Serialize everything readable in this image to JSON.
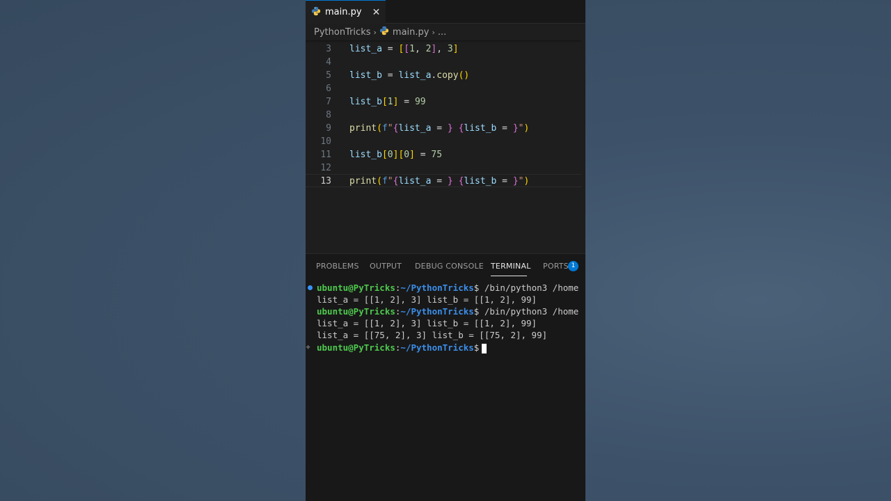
{
  "tab": {
    "label": "main.py",
    "close": "✕",
    "icon": "python-icon"
  },
  "breadcrumb": {
    "folder": "PythonTricks",
    "file": "main.py",
    "more": "...",
    "sep": "›"
  },
  "editor": {
    "current_line": 13,
    "lines": [
      {
        "num": "3"
      },
      {
        "num": "4"
      },
      {
        "num": "5"
      },
      {
        "num": "6"
      },
      {
        "num": "7"
      },
      {
        "num": "8"
      },
      {
        "num": "9"
      },
      {
        "num": "10"
      },
      {
        "num": "11"
      },
      {
        "num": "12"
      },
      {
        "num": "13"
      }
    ],
    "tokens": {
      "l3": [
        "list_a",
        " = ",
        "[",
        "[",
        "1",
        ", ",
        "2",
        "]",
        ", ",
        "3",
        "]"
      ],
      "l5": [
        "list_b",
        " = ",
        "list_a",
        ".",
        "copy",
        "(",
        ")"
      ],
      "l7": [
        "list_b",
        "[",
        "1",
        "]",
        " = ",
        "99"
      ],
      "l9": [
        "print",
        "(",
        "f",
        "\"",
        "{",
        "list_a",
        " = ",
        "}",
        " ",
        "{",
        "list_b",
        " = ",
        "}",
        "\"",
        ")"
      ],
      "l11": [
        "list_b",
        "[",
        "0",
        "]",
        "[",
        "0",
        "]",
        " = ",
        "75"
      ],
      "l13": [
        "print",
        "(",
        "f",
        "\"",
        "{",
        "list_a",
        " = ",
        "}",
        " ",
        "{",
        "list_b",
        " = ",
        "}",
        "\"",
        ")"
      ]
    }
  },
  "panel": {
    "tabs": [
      "PROBLEMS",
      "OUTPUT",
      "DEBUG CONSOLE",
      "TERMINAL",
      "PORTS"
    ],
    "active_tab": "TERMINAL",
    "ports_badge": "1"
  },
  "terminal": {
    "user": "ubuntu@PyTricks",
    "colon": ":",
    "path": "~/PythonTricks",
    "prompt_end": "$",
    "cmd1": " /bin/python3 /home",
    "out1": "list_a = [[1, 2], 3] list_b = [[1, 2], 99]",
    "cmd2": " /bin/python3 /home",
    "out2a": "list_a = [[1, 2], 3] list_b = [[1, 2], 99]",
    "out2b": "list_a = [[75, 2], 3] list_b = [[75, 2], 99]"
  },
  "colors": {
    "accent": "#0078d4",
    "editor_bg": "#1e1e1e",
    "panel_bg": "#181818",
    "prompt_user": "#4ec94e",
    "prompt_path": "#3b8eea"
  }
}
